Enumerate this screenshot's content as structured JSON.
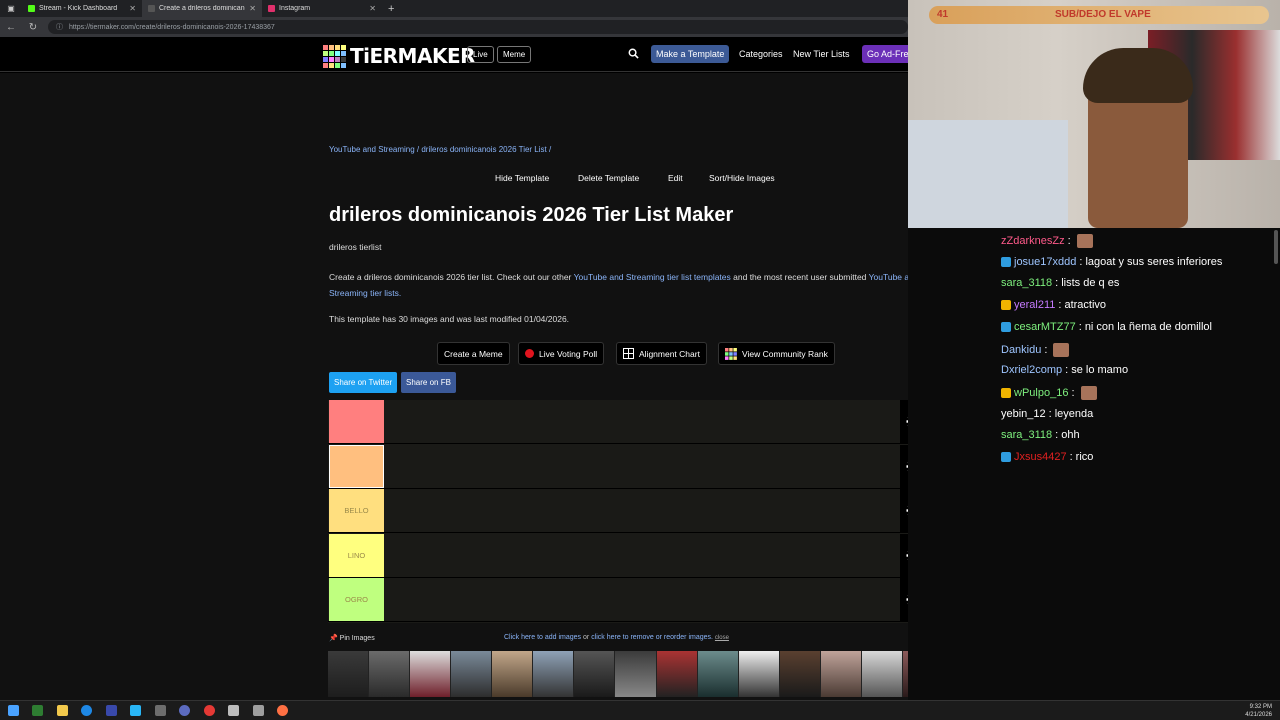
{
  "browser": {
    "tabs": [
      {
        "title": "Stream - Kick Dashboard",
        "color": "#53fc18"
      },
      {
        "title": "Create a drileros dominicanois 20...",
        "color": "#555555"
      },
      {
        "title": "Instagram",
        "color": "#e1306c"
      }
    ],
    "url_host": "tiermaker.com",
    "url_path": "/create/drileros-dominicanois-2026-17438367",
    "url_full": "https://tiermaker.com/create/drileros-dominicanois-2026-17438367"
  },
  "site": {
    "logo": "TiERMAKER",
    "live": "Live",
    "meme": "Meme",
    "make_template": "Make a Template",
    "categories": "Categories",
    "new_tier_lists": "New Tier Lists",
    "ad_free": "Go Ad-Free"
  },
  "page": {
    "breadcrumb": "YouTube and Streaming / drileros dominicanois 2026 Tier List /",
    "actions": [
      "Hide Template",
      "Delete Template",
      "Edit",
      "Sort/Hide Images"
    ],
    "title": "drileros dominicanois 2026 Tier List Maker",
    "subtitle": "drileros tierlist",
    "desc_1": "Create a drileros dominicanois 2026 tier list. Check out our other",
    "desc_link_1": "YouTube and Streaming tier list templates",
    "desc_2": "and the most recent user submitted",
    "desc_link_2": "YouTube and Streaming tier lists.",
    "info": "This template has 30 images and was last modified 01/04/2026.",
    "tool_buttons": [
      "Create a Meme",
      "Live Voting Poll",
      "Alignment Chart",
      "View Community Rank"
    ],
    "share_twitter": "Share on Twitter",
    "share_fb": "Share on FB"
  },
  "tiers": [
    {
      "label": "",
      "color": "#ff7f7f"
    },
    {
      "label": "",
      "color": "#ffbf7f"
    },
    {
      "label": "BELLO",
      "color": "#ffdf7f"
    },
    {
      "label": "LINO",
      "color": "#ffff7f"
    },
    {
      "label": "OGRO",
      "color": "#bfff7f"
    }
  ],
  "footer": {
    "pin_images": "Pin Images",
    "add_images": "Click here to add images",
    "or": "or",
    "remove_images": "click here to remove or reorder images.",
    "close": "close"
  },
  "stream": {
    "goal_count": "41",
    "goal_text": "SUB/DEJO EL VAPE"
  },
  "chat": [
    {
      "user": "zZdarknesZz",
      "color": "#ff5a8a",
      "text": "",
      "badge": "",
      "emote": true
    },
    {
      "user": "josue17xddd",
      "color": "#9ec5ff",
      "text": "lagoat y sus seres inferiores",
      "badge": "#2f9de0",
      "emote": false
    },
    {
      "user": "sara_3118",
      "color": "#7ef07e",
      "text": "lists de q es",
      "badge": "",
      "emote": false
    },
    {
      "user": "yeral211",
      "color": "#c57bff",
      "text": "atractivo",
      "badge": "#f0b400",
      "emote": false
    },
    {
      "user": "cesarMTZ77",
      "color": "#7ef07e",
      "text": "ni con la ñema de domillol",
      "badge": "#2f9de0",
      "emote": false
    },
    {
      "user": "Dankidu",
      "color": "#9ec5ff",
      "text": "",
      "badge": "",
      "emote": true
    },
    {
      "user": "Dxriel2comp",
      "color": "#9ec5ff",
      "text": "se lo mamo",
      "badge": "",
      "emote": false
    },
    {
      "user": "wPulpo_16",
      "color": "#7ef07e",
      "text": "",
      "badge": "#f0b400",
      "emote": true
    },
    {
      "user": "yebin_12",
      "color": "#ffffff",
      "text": "leyenda",
      "badge": "",
      "emote": false
    },
    {
      "user": "sara_3118",
      "color": "#7ef07e",
      "text": "ohh",
      "badge": "",
      "emote": false
    },
    {
      "user": "Jxsus4427",
      "color": "#e02020",
      "text": "rico",
      "badge": "#2f9de0",
      "emote": false
    }
  ],
  "taskbar": {
    "time": "9:32 PM",
    "date": "4/21/2026"
  }
}
